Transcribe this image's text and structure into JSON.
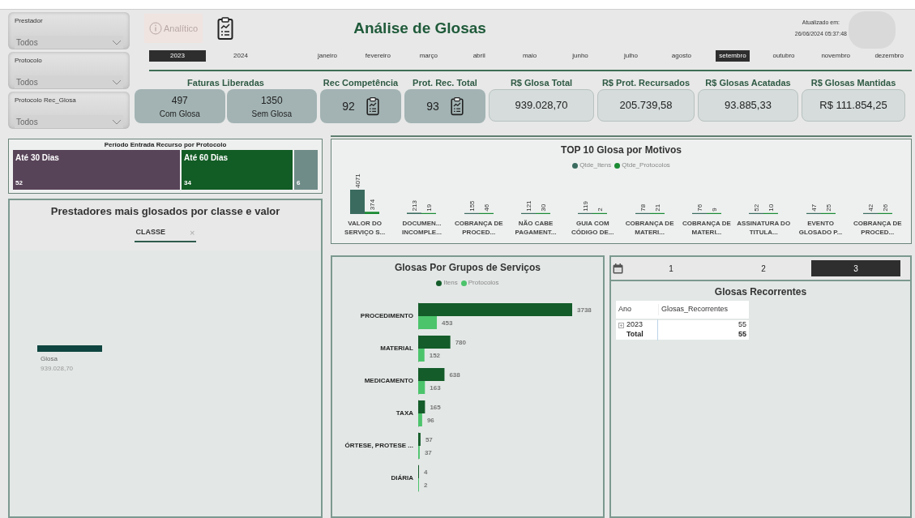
{
  "slicers": [
    {
      "label": "Prestador",
      "value": "Todos"
    },
    {
      "label": "Protocolo",
      "value": "Todos"
    },
    {
      "label": "Protocolo Rec_Glosa",
      "value": "Todos"
    }
  ],
  "header": {
    "analitico_button": "Analítico",
    "title": "Análise de Glosas",
    "updated_label": "Atualizado em:",
    "updated_value": "26/06/2024 05:37:48"
  },
  "years": [
    {
      "label": "2023",
      "selected": true
    },
    {
      "label": "2024",
      "selected": false
    }
  ],
  "months": [
    {
      "label": "janeiro",
      "selected": false
    },
    {
      "label": "fevereiro",
      "selected": false
    },
    {
      "label": "março",
      "selected": false
    },
    {
      "label": "abril",
      "selected": false
    },
    {
      "label": "maio",
      "selected": false
    },
    {
      "label": "junho",
      "selected": false
    },
    {
      "label": "julho",
      "selected": false
    },
    {
      "label": "agosto",
      "selected": false
    },
    {
      "label": "setembro",
      "selected": true
    },
    {
      "label": "outubro",
      "selected": false
    },
    {
      "label": "novembro",
      "selected": false
    },
    {
      "label": "dezembro",
      "selected": false
    }
  ],
  "kpi_groups": [
    {
      "title": "Faturas Liberadas",
      "cards": [
        {
          "kind": "split",
          "value": "497",
          "caption": "Com Glosa"
        },
        {
          "kind": "split",
          "value": "1350",
          "caption": "Sem Glosa"
        }
      ]
    },
    {
      "title": "Rec Competência",
      "cards": [
        {
          "kind": "icon",
          "value": "92"
        }
      ]
    },
    {
      "title": "Prot. Rec. Total",
      "cards": [
        {
          "kind": "icon",
          "value": "93"
        }
      ]
    },
    {
      "title": "R$ Glosa Total",
      "cards": [
        {
          "kind": "plain",
          "value": "939.028,70"
        }
      ]
    },
    {
      "title": "R$ Prot. Recursados",
      "cards": [
        {
          "kind": "plain",
          "value": "205.739,58"
        }
      ]
    },
    {
      "title": "R$ Glosas Acatadas",
      "cards": [
        {
          "kind": "plain",
          "value": "93.885,33"
        }
      ]
    },
    {
      "title": "R$ Glosas Mantidas",
      "cards": [
        {
          "kind": "plain",
          "value": "R$ 111.854,25"
        }
      ]
    }
  ],
  "period_panel": {
    "title": "Período Entrada Recurso por Protocolo",
    "segments": [
      {
        "label": "Até 30 Dias",
        "value": "52",
        "color": "#584459"
      },
      {
        "label": "Até 60 Dias",
        "value": "34",
        "color": "#125c25"
      },
      {
        "value": "6",
        "color": "#6f8c88"
      }
    ]
  },
  "prestadores_panel": {
    "title": "Prestadores mais glosados por classe e valor",
    "filter_chip": "CLASSE",
    "filter_close": "×",
    "items": [
      {
        "label": "Glosa",
        "value": "939.028,70"
      }
    ]
  },
  "top10": {
    "chart_data": {
      "type": "bar",
      "title": "TOP 10 Glosa por Motivos",
      "categories": [
        "VALOR DO SERVIÇO S...",
        "DOCUMEN... INCOMPLE...",
        "COBRANÇA DE PROCED...",
        "NÃO CABE PAGAMENT...",
        "GUIA COM CÓDIGO DE...",
        "COBRANÇA DE MATERI...",
        "COBRANÇA DE MATERI...",
        "ASSINATURA DO TITULA...",
        "EVENTO GLOSADO P...",
        "COBRANÇA DE PROCED..."
      ],
      "series": [
        {
          "name": "Qtde_Itens",
          "color": "#3b6b5f",
          "values": [
            4071,
            213,
            155,
            121,
            119,
            78,
            76,
            52,
            47,
            42
          ]
        },
        {
          "name": "Qtde_Protocolos",
          "color": "#1a8a33",
          "values": [
            374,
            19,
            46,
            30,
            2,
            21,
            9,
            10,
            25,
            26
          ]
        }
      ],
      "data_labels": true,
      "legend": "top"
    }
  },
  "grupos": {
    "chart_data": {
      "type": "bar",
      "orientation": "horizontal",
      "title": "Glosas Por Grupos de Serviços",
      "categories": [
        "PROCEDIMENTO",
        "MATERIAL",
        "MEDICAMENTO",
        "TAXA",
        "ÓRTESE, PROTESE ...",
        "DIÁRIA"
      ],
      "series": [
        {
          "name": "Itens",
          "color": "#145c2a",
          "values": [
            3738,
            780,
            638,
            165,
            57,
            4
          ]
        },
        {
          "name": "Protocolos",
          "color": "#4cc46c",
          "values": [
            453,
            152,
            163,
            96,
            37,
            2
          ]
        }
      ],
      "data_labels": true,
      "legend": "top"
    }
  },
  "page_tabs": [
    {
      "label": "1",
      "selected": false
    },
    {
      "label": "2",
      "selected": false
    },
    {
      "label": "3",
      "selected": true
    }
  ],
  "recorrentes": {
    "title": "Glosas Recorrentes",
    "columns": [
      "Ano",
      "Glosas_Recorrentes"
    ],
    "rows": [
      {
        "kind": "year",
        "cells": [
          "2023",
          "55"
        ]
      },
      {
        "kind": "total",
        "cells": [
          "Total",
          "55"
        ]
      }
    ]
  }
}
